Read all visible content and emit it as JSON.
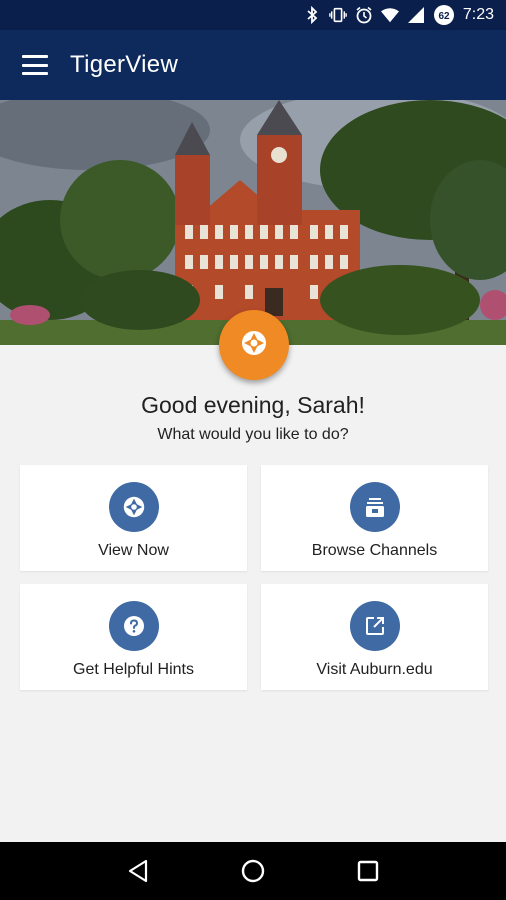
{
  "status_bar": {
    "time": "7:23",
    "battery": "62",
    "icons": [
      "bluetooth-icon",
      "vibrate-icon",
      "alarm-icon",
      "wifi-icon",
      "signal-icon",
      "battery-icon"
    ]
  },
  "app_bar": {
    "title": "TigerView",
    "menu_icon": "hamburger-menu-icon"
  },
  "hero": {
    "image": "campus-clock-tower-photo"
  },
  "fab": {
    "icon": "camera-shutter-icon",
    "color": "#f08a24"
  },
  "greeting": {
    "title": "Good evening, Sarah!",
    "subtitle": "What would you like to do?"
  },
  "actions": [
    {
      "label": "View Now",
      "icon": "camera-shutter-icon"
    },
    {
      "label": "Browse Channels",
      "icon": "channels-icon"
    },
    {
      "label": "Get Helpful Hints",
      "icon": "help-icon"
    },
    {
      "label": "Visit Auburn.edu",
      "icon": "external-link-icon"
    }
  ],
  "colors": {
    "status_bar": "#0b1f4d",
    "app_bar": "#0e2a5c",
    "accent": "#f08a24",
    "icon_circle": "#3f6aa3",
    "background": "#f2f2f2"
  },
  "nav_bar": {
    "buttons": [
      "back-icon",
      "home-icon",
      "recents-icon"
    ]
  }
}
